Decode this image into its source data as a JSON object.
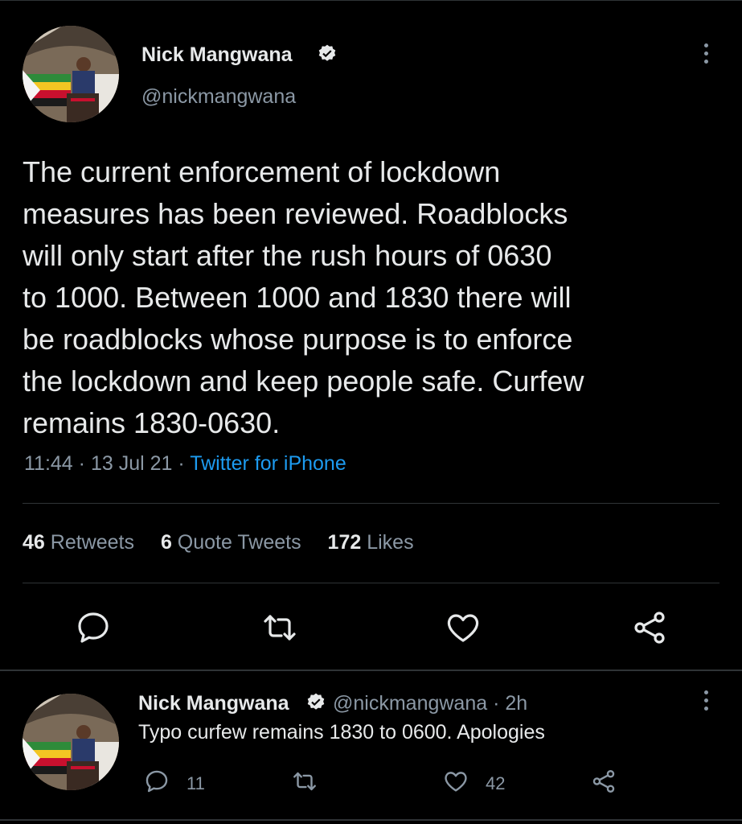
{
  "tweet": {
    "author_name": "Nick Mangwana",
    "author_handle": "@nickmangwana",
    "text": "The current enforcement of lockdown\nmeasures has been reviewed. Roadblocks\nwill only start after the rush hours of 0630\nto 1000. Between 1000 and 1830 there will\nbe roadblocks whose purpose is to enforce\nthe lockdown and keep people safe. Curfew\nremains 1830-0630.",
    "time": "11:44",
    "date": "13 Jul 21",
    "separator": "·",
    "source": "Twitter for iPhone",
    "stats": {
      "retweets_count": "46",
      "retweets_label": "Retweets",
      "quotes_count": "6",
      "quotes_label": "Quote Tweets",
      "likes_count": "172",
      "likes_label": "Likes"
    }
  },
  "reply": {
    "author_name": "Nick Mangwana",
    "author_handle": "@nickmangwana",
    "age": "· 2h",
    "text": "Typo curfew remains 1830 to 0600. Apologies",
    "reply_count": "11",
    "like_count": "42"
  },
  "colors": {
    "accent": "#1d9bf0",
    "background": "#000000",
    "muted": "#8b98a5",
    "text": "#e7e9ea"
  },
  "icons": [
    "verified-badge-icon",
    "more-options-icon",
    "reply-icon",
    "retweet-icon",
    "like-icon",
    "share-icon"
  ]
}
